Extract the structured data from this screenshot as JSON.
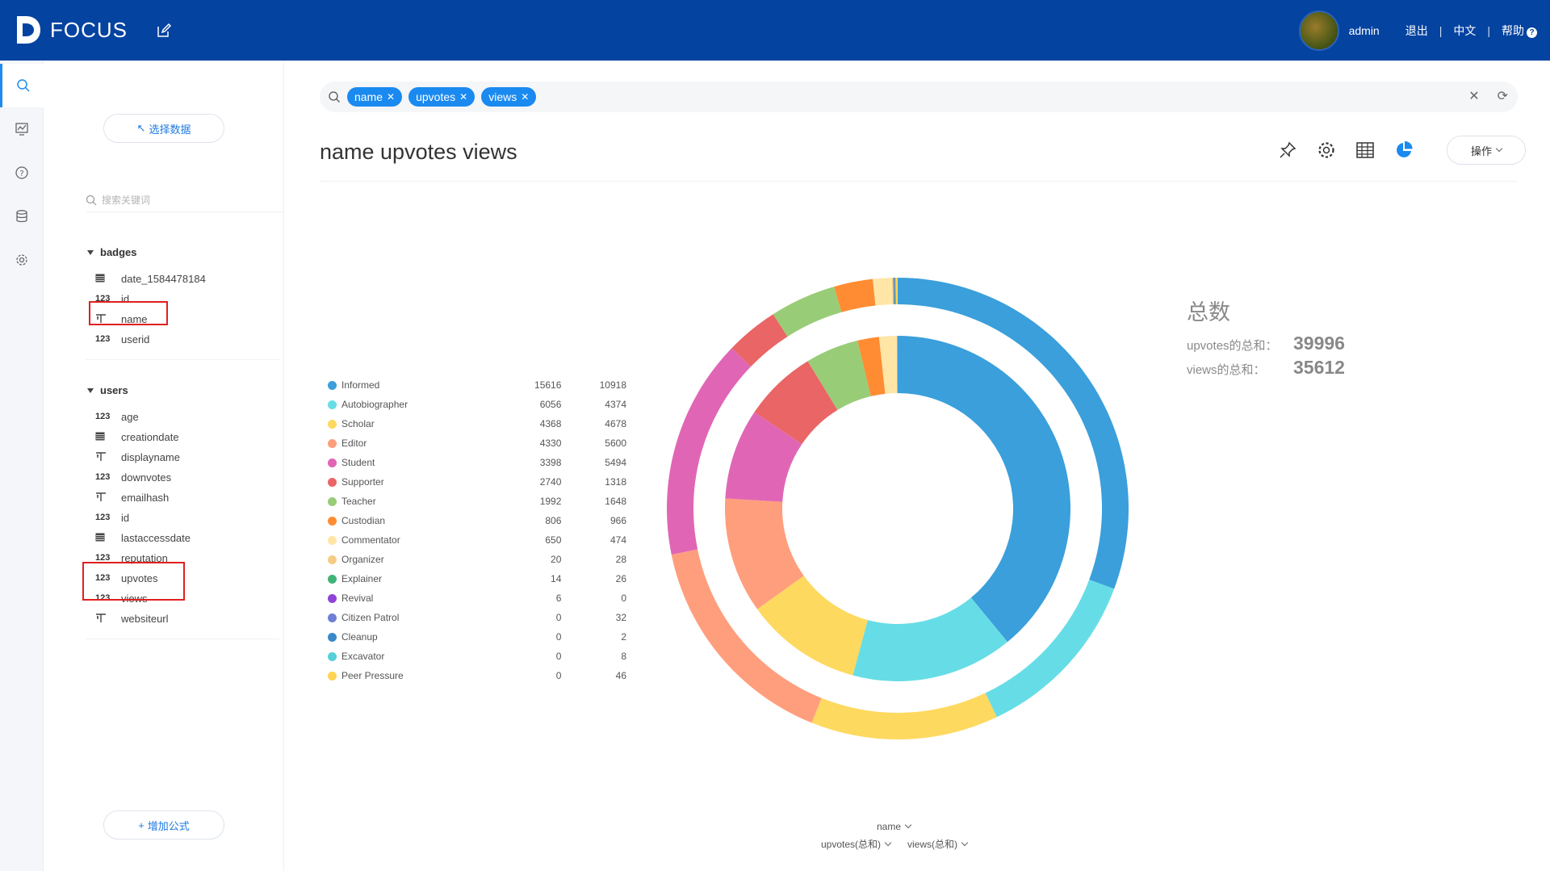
{
  "header": {
    "logo_text": "FOCUS",
    "user_name": "admin",
    "logout": "退出",
    "language": "中文",
    "help": "帮助",
    "brand_color": "#0443a0"
  },
  "rail": {
    "items": [
      "search-icon",
      "dashboard-icon",
      "help-icon",
      "database-icon",
      "settings-icon"
    ]
  },
  "panel": {
    "select_data": "选择数据",
    "search_placeholder": "搜索关键词",
    "add_formula": "增加公式",
    "groups": [
      {
        "name": "badges",
        "fields": [
          {
            "type": "date",
            "name": "date_1584478184"
          },
          {
            "type": "123",
            "name": "id"
          },
          {
            "type": "text",
            "name": "name"
          },
          {
            "type": "123",
            "name": "userid"
          }
        ]
      },
      {
        "name": "users",
        "fields": [
          {
            "type": "123",
            "name": "age"
          },
          {
            "type": "date",
            "name": "creationdate"
          },
          {
            "type": "text",
            "name": "displayname"
          },
          {
            "type": "123",
            "name": "downvotes"
          },
          {
            "type": "text",
            "name": "emailhash"
          },
          {
            "type": "123",
            "name": "id"
          },
          {
            "type": "date",
            "name": "lastaccessdate"
          },
          {
            "type": "123",
            "name": "reputation"
          },
          {
            "type": "123",
            "name": "upvotes"
          },
          {
            "type": "123",
            "name": "views"
          },
          {
            "type": "text",
            "name": "websiteurl"
          }
        ]
      }
    ],
    "type_label_number": "123",
    "type_label_text": "T"
  },
  "search": {
    "chips": [
      "name",
      "upvotes",
      "views"
    ]
  },
  "main": {
    "title": "name upvotes views",
    "operation": "操作"
  },
  "totals": {
    "title": "总数",
    "upvotes_label": "upvotes的总和：",
    "upvotes_value": "39996",
    "views_label": "views的总和：",
    "views_value": "35612"
  },
  "axis": {
    "name": "name",
    "upvotes": "upvotes(总和)",
    "views": "views(总和)"
  },
  "chart_data": {
    "type": "pie",
    "categories": [
      "Informed",
      "Autobiographer",
      "Scholar",
      "Editor",
      "Student",
      "Supporter",
      "Teacher",
      "Custodian",
      "Commentator",
      "Organizer",
      "Explainer",
      "Revival",
      "Citizen Patrol",
      "Cleanup",
      "Excavator",
      "Peer Pressure"
    ],
    "colors": [
      "#3a9fdb",
      "#66dde6",
      "#fed960",
      "#ff9e7d",
      "#e066b5",
      "#ea6565",
      "#99cc77",
      "#ff8c33",
      "#ffe6a7",
      "#f5cc85",
      "#40b377",
      "#8e44d6",
      "#6f7fd6",
      "#3a89c9",
      "#55d0d8",
      "#ffd452"
    ],
    "series": [
      {
        "name": "upvotes(总和)",
        "values": [
          15616,
          6056,
          4368,
          4330,
          3398,
          2740,
          1992,
          806,
          650,
          20,
          14,
          6,
          0,
          0,
          0,
          0
        ]
      },
      {
        "name": "views(总和)",
        "values": [
          10918,
          4374,
          4678,
          5600,
          5494,
          1318,
          1648,
          966,
          474,
          28,
          26,
          0,
          32,
          2,
          8,
          46
        ]
      }
    ]
  }
}
